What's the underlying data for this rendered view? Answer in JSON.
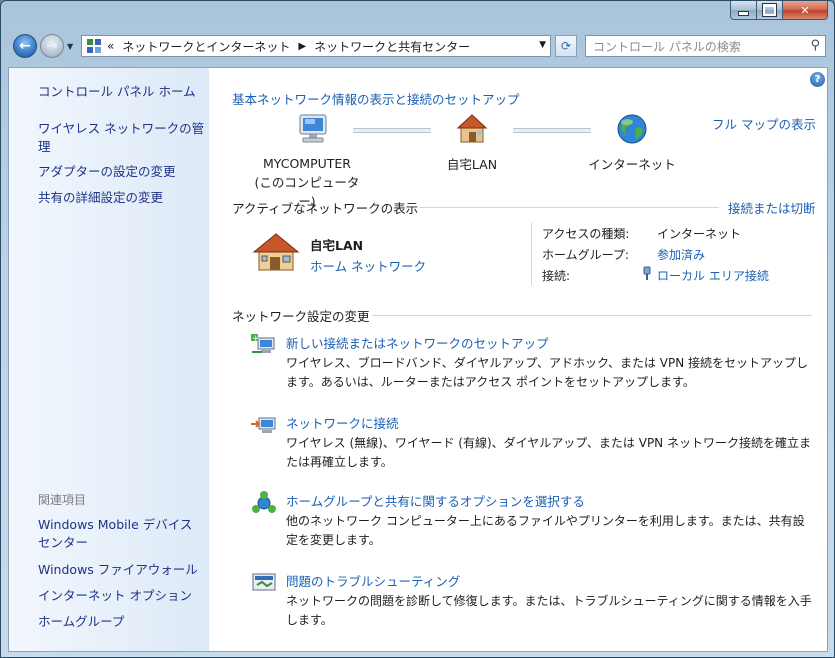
{
  "address": {
    "crumbs": [
      "«",
      "ネットワークとインターネット",
      "ネットワークと共有センター"
    ]
  },
  "search": {
    "placeholder": "コントロール パネルの検索"
  },
  "sidebar": {
    "items": [
      "コントロール パネル ホーム",
      "ワイヤレス ネットワークの管理",
      "アダプターの設定の変更",
      "共有の詳細設定の変更"
    ],
    "related_heading": "関連項目",
    "related": [
      "Windows Mobile デバイス センター",
      "Windows ファイアウォール",
      "インターネット オプション",
      "ホームグループ"
    ]
  },
  "main": {
    "title": "基本ネットワーク情報の表示と接続のセットアップ",
    "full_map": "フル マップの表示",
    "map": {
      "computer_name": "MYCOMPUTER",
      "computer_sub": "(このコンピューター)",
      "network": "自宅LAN",
      "internet": "インターネット"
    },
    "active": {
      "heading": "アクティブなネットワークの表示",
      "connect_link": "接続または切断",
      "network_name": "自宅LAN",
      "network_type": "ホーム ネットワーク",
      "access_label": "アクセスの種類:",
      "access_value": "インターネット",
      "homegroup_label": "ホームグループ:",
      "homegroup_value": "参加済み",
      "connection_label": "接続:",
      "connection_value": "ローカル エリア接続"
    },
    "change": {
      "heading": "ネットワーク設定の変更",
      "tasks": [
        {
          "title": "新しい接続またはネットワークのセットアップ",
          "desc": "ワイヤレス、ブロードバンド、ダイヤルアップ、アドホック、または VPN 接続をセットアップします。あるいは、ルーターまたはアクセス ポイントをセットアップします。"
        },
        {
          "title": "ネットワークに接続",
          "desc": "ワイヤレス (無線)、ワイヤード (有線)、ダイヤルアップ、または VPN ネットワーク接続を確立または再確立します。"
        },
        {
          "title": "ホームグループと共有に関するオプションを選択する",
          "desc": "他のネットワーク コンピューター上にあるファイルやプリンターを利用します。または、共有設定を変更します。"
        },
        {
          "title": "問題のトラブルシューティング",
          "desc": "ネットワークの問題を診断して修復します。または、トラブルシューティングに関する情報を入手します。"
        }
      ]
    }
  }
}
